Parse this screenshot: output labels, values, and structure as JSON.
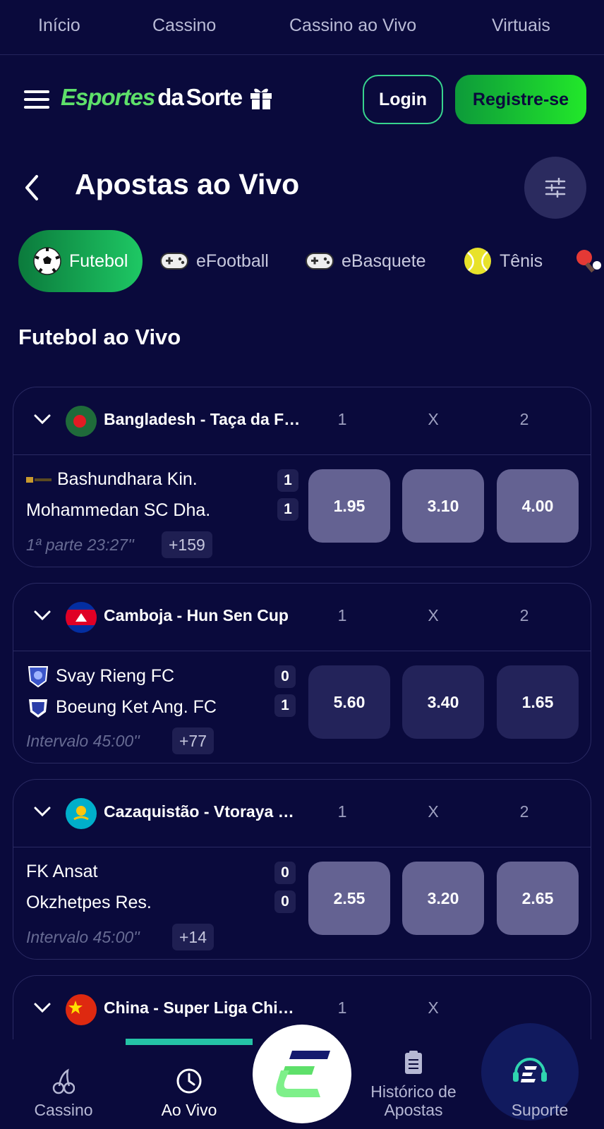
{
  "topnav": {
    "items": [
      "Início",
      "Cassino",
      "Cassino ao Vivo",
      "Virtuais"
    ]
  },
  "header": {
    "logo_text_1": "Esportes",
    "logo_text_2": "da",
    "logo_text_3": "Sorte",
    "login_label": "Login",
    "register_label": "Registre-se"
  },
  "page": {
    "title": "Apostas ao Vivo",
    "section_title": "Futebol ao Vivo"
  },
  "sport_tabs": [
    {
      "label": "Futebol",
      "icon": "soccer-ball-icon",
      "active": true
    },
    {
      "label": "eFootball",
      "icon": "gamepad-icon",
      "active": false
    },
    {
      "label": "eBasquete",
      "icon": "gamepad-icon",
      "active": false
    },
    {
      "label": "Tênis",
      "icon": "tennis-ball-icon",
      "active": false
    },
    {
      "label": "",
      "icon": "ping-pong-icon",
      "active": false
    }
  ],
  "odds_headers": [
    "1",
    "X",
    "2"
  ],
  "matches": [
    {
      "league": "Bangladesh - Taça da Federação",
      "flag": "bangladesh-flag",
      "home": "Bashundhara Kin.",
      "away": "Mohammedan SC Dha.",
      "home_score": "1",
      "away_score": "1",
      "status": "1ª parte 23:27''",
      "more": "+159",
      "odds": [
        "1.95",
        "3.10",
        "4.00"
      ]
    },
    {
      "league": "Camboja - Hun Sen Cup",
      "flag": "cambodia-flag",
      "home": "Svay Rieng FC",
      "away": "Boeung Ket Ang. FC",
      "home_score": "0",
      "away_score": "1",
      "status": "Intervalo 45:00''",
      "more": "+77",
      "odds": [
        "5.60",
        "3.40",
        "1.65"
      ]
    },
    {
      "league": "Cazaquistão - Vtoraya Liga",
      "flag": "kazakhstan-flag",
      "home": "FK Ansat",
      "away": "Okzhetpes Res.",
      "home_score": "0",
      "away_score": "0",
      "status": "Intervalo 45:00''",
      "more": "+14",
      "odds": [
        "2.55",
        "3.20",
        "2.65"
      ]
    },
    {
      "league": "China - Super Liga Chinesa",
      "flag": "china-flag"
    }
  ],
  "bottomnav": {
    "cassino": "Cassino",
    "ao_vivo": "Ao Vivo",
    "historico_1": "Histórico de",
    "historico_2": "Apostas",
    "suporte": "Suporte"
  },
  "colors": {
    "background": "#0a0a3c",
    "accent_green": "#22e82a",
    "odd_light": "#646292",
    "odd_dark": "#23235a",
    "active_indicator": "#25c3a6"
  }
}
